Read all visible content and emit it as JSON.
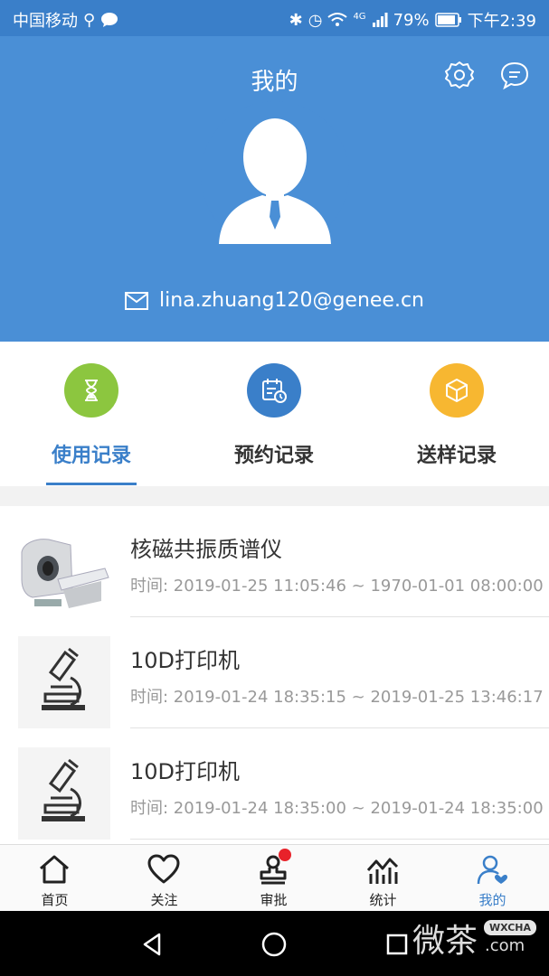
{
  "status_bar": {
    "carrier": "中国移动",
    "battery": "79%",
    "time": "下午2:39",
    "network": "4G"
  },
  "header": {
    "title": "我的",
    "email": "lina.zhuang120@genee.cn"
  },
  "tabs": [
    {
      "label": "使用记录",
      "icon": "hourglass-icon",
      "color": "#8cc63f",
      "active": true
    },
    {
      "label": "预约记录",
      "icon": "calendar-clock-icon",
      "color": "#3a7fc9",
      "active": false
    },
    {
      "label": "送样记录",
      "icon": "box-icon",
      "color": "#f7b731",
      "active": false
    }
  ],
  "records": [
    {
      "name": "核磁共振质谱仪",
      "time": "时间:  2019-01-25 11:05:46 ~ 1970-01-01 08:00:00",
      "thumb": "ct-scanner-image"
    },
    {
      "name": "10D打印机",
      "time": "时间:  2019-01-24 18:35:15 ~ 2019-01-25 13:46:17",
      "thumb": "microscope-icon"
    },
    {
      "name": "10D打印机",
      "time": "时间:  2019-01-24 18:35:00 ~ 2019-01-24 18:35:00",
      "thumb": "microscope-icon"
    }
  ],
  "bottom_nav": [
    {
      "label": "首页",
      "icon": "home-icon"
    },
    {
      "label": "关注",
      "icon": "heart-icon"
    },
    {
      "label": "审批",
      "icon": "stamp-icon",
      "badge": true
    },
    {
      "label": "统计",
      "icon": "chart-icon"
    },
    {
      "label": "我的",
      "icon": "user-icon",
      "active": true
    }
  ],
  "watermark": {
    "text": "微茶",
    "badge": "WXCHA",
    "domain": ".com"
  },
  "colors": {
    "primary": "#4a8fd6",
    "accent": "#3a7fc9",
    "badge": "#e8222a"
  }
}
